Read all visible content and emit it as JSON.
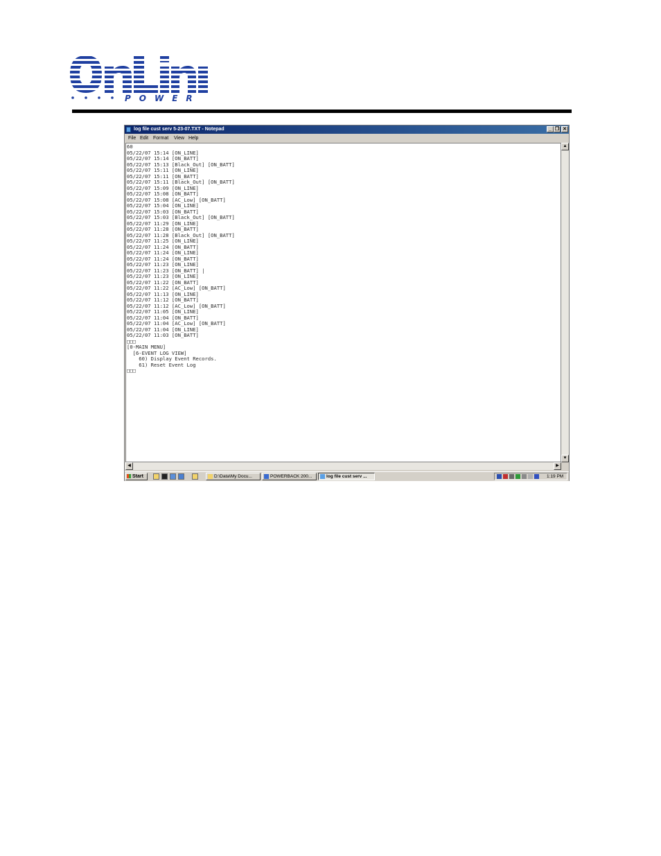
{
  "brand": {
    "logo_top": "OnLine",
    "logo_bottom": "POWER"
  },
  "window": {
    "title": "log file cust serv 5-23-07.TXT - Notepad",
    "minimize": "_",
    "restore": "❐",
    "close": "✕"
  },
  "menu": [
    "File",
    "Edit",
    "Format",
    "View",
    "Help"
  ],
  "log_text": "60\n05/22/07 15:14 [ON_LINE]\n05/22/07 15:14 [ON_BATT]\n05/22/07 15:13 [Black_Out] [ON_BATT]\n05/22/07 15:11 [ON_LINE]\n05/22/07 15:11 [ON_BATT]\n05/22/07 15:11 [Black_Out] [ON_BATT]\n05/22/07 15:09 [ON_LINE]\n05/22/07 15:08 [ON_BATT]\n05/22/07 15:08 [AC_Low] [ON_BATT]\n05/22/07 15:04 [ON_LINE]\n05/22/07 15:03 [ON_BATT]\n05/22/07 15:03 [Black_Out] [ON_BATT]\n05/22/07 11:29 [ON_LINE]\n05/22/07 11:28 [ON_BATT]\n05/22/07 11:28 [Black_Out] [ON_BATT]\n05/22/07 11:25 [ON_LINE]\n05/22/07 11:24 [ON_BATT]\n05/22/07 11:24 [ON_LINE]\n05/22/07 11:24 [ON_BATT]\n05/22/07 11:23 [ON_LINE]\n05/22/07 11:23 [ON_BATT] |\n05/22/07 11:23 [ON_LINE]\n05/22/07 11:22 [ON_BATT]\n05/22/07 11:22 [AC_Low] [ON_BATT]\n05/22/07 11:13 [ON_LINE]\n05/22/07 11:12 [ON_BATT]\n05/22/07 11:12 [AC_Low] [ON_BATT]\n05/22/07 11:05 [ON_LINE]\n05/22/07 11:04 [ON_BATT]\n05/22/07 11:04 [AC_Low] [ON_BATT]\n05/22/07 11:04 [ON_LINE]\n05/22/07 11:03 [ON_BATT]\n□□□\n[0-MAIN MENU]\n  [6-EVENT LOG VIEW]\n    60) Display Event Records.\n    61) Reset Event Log\n□□□",
  "taskbar": {
    "start": "Start",
    "tasks": [
      {
        "label": "D:\\Data\\My Docu...",
        "active": false
      },
      {
        "label": "POWERBACK 200...",
        "active": false
      },
      {
        "label": "log file cust serv ...",
        "active": true
      }
    ],
    "clock": "1:19 PM"
  },
  "colors": {
    "titlebar": "#0a246a",
    "logo_blue": "#1f3fa0",
    "chrome": "#d4d0c8"
  }
}
